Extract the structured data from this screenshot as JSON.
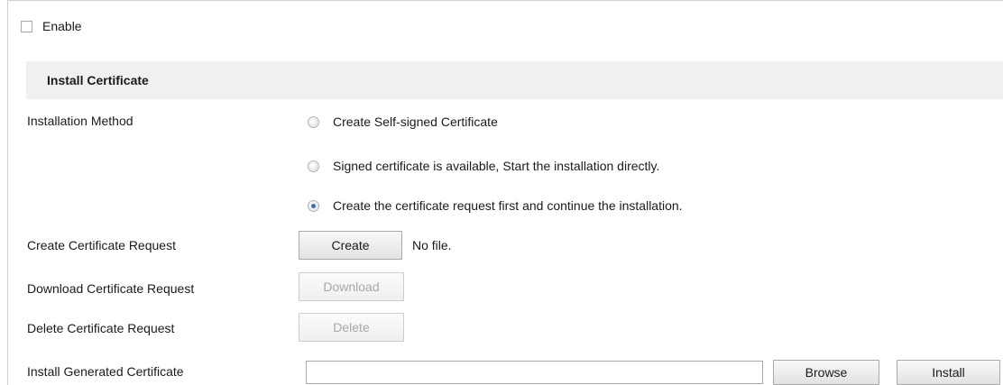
{
  "enable": {
    "label": "Enable",
    "checked": false
  },
  "section": {
    "title": "Install Certificate"
  },
  "installation_method": {
    "label": "Installation Method",
    "options": [
      {
        "label": "Create Self-signed Certificate",
        "selected": false
      },
      {
        "label": "Signed certificate is available, Start the installation directly.",
        "selected": false
      },
      {
        "label": "Create the certificate request first and continue the installation.",
        "selected": true
      }
    ]
  },
  "create_request": {
    "label": "Create Certificate Request",
    "button": "Create",
    "file_status": "No file."
  },
  "download_request": {
    "label": "Download Certificate Request",
    "button": "Download",
    "disabled": true
  },
  "delete_request": {
    "label": "Delete Certificate Request",
    "button": "Delete",
    "disabled": true
  },
  "install_generated": {
    "label": "Install Generated Certificate",
    "file_value": "",
    "browse_button": "Browse",
    "install_button": "Install"
  }
}
